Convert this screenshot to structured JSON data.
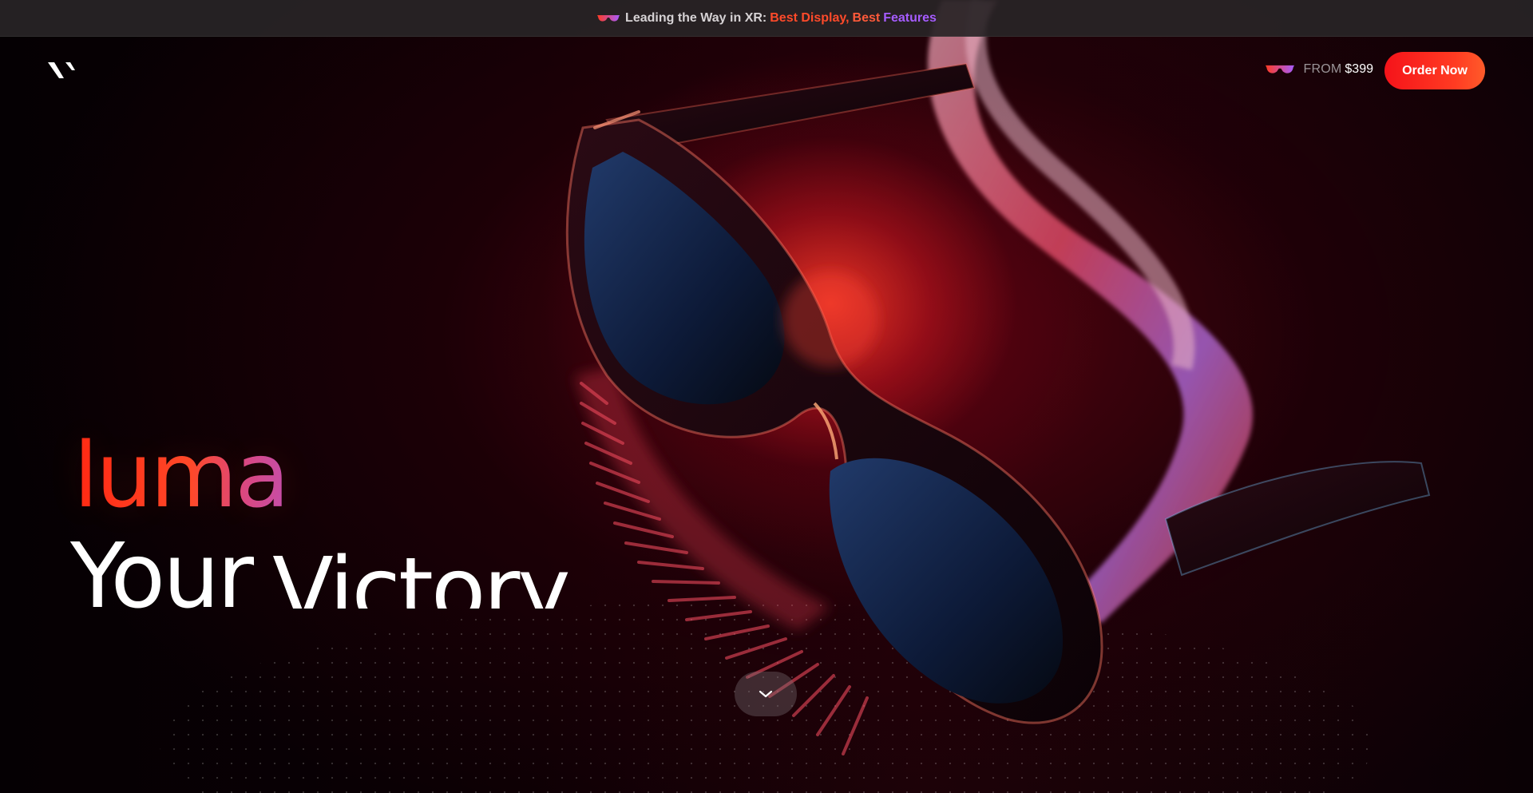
{
  "announcement": {
    "icon": "xr-glasses-icon",
    "prefix": "Leading the Way in XR:",
    "highlight_1": "Best Display,",
    "highlight_2": "Best",
    "highlight_3": "Features"
  },
  "header": {
    "logo": "brand-logo",
    "price_icon": "xr-glasses-icon",
    "price_prefix": "FROM",
    "price_value": "$399",
    "order_button": "Order Now"
  },
  "hero": {
    "brand_word": "luma",
    "tagline_word_1": "Your",
    "tagline_word_2": "Victory",
    "scroll_icon": "chevron-down-icon"
  },
  "colors": {
    "accent_red": "#ff3b22",
    "accent_purple": "#a65cff",
    "announcement_bg": "#28242a"
  }
}
